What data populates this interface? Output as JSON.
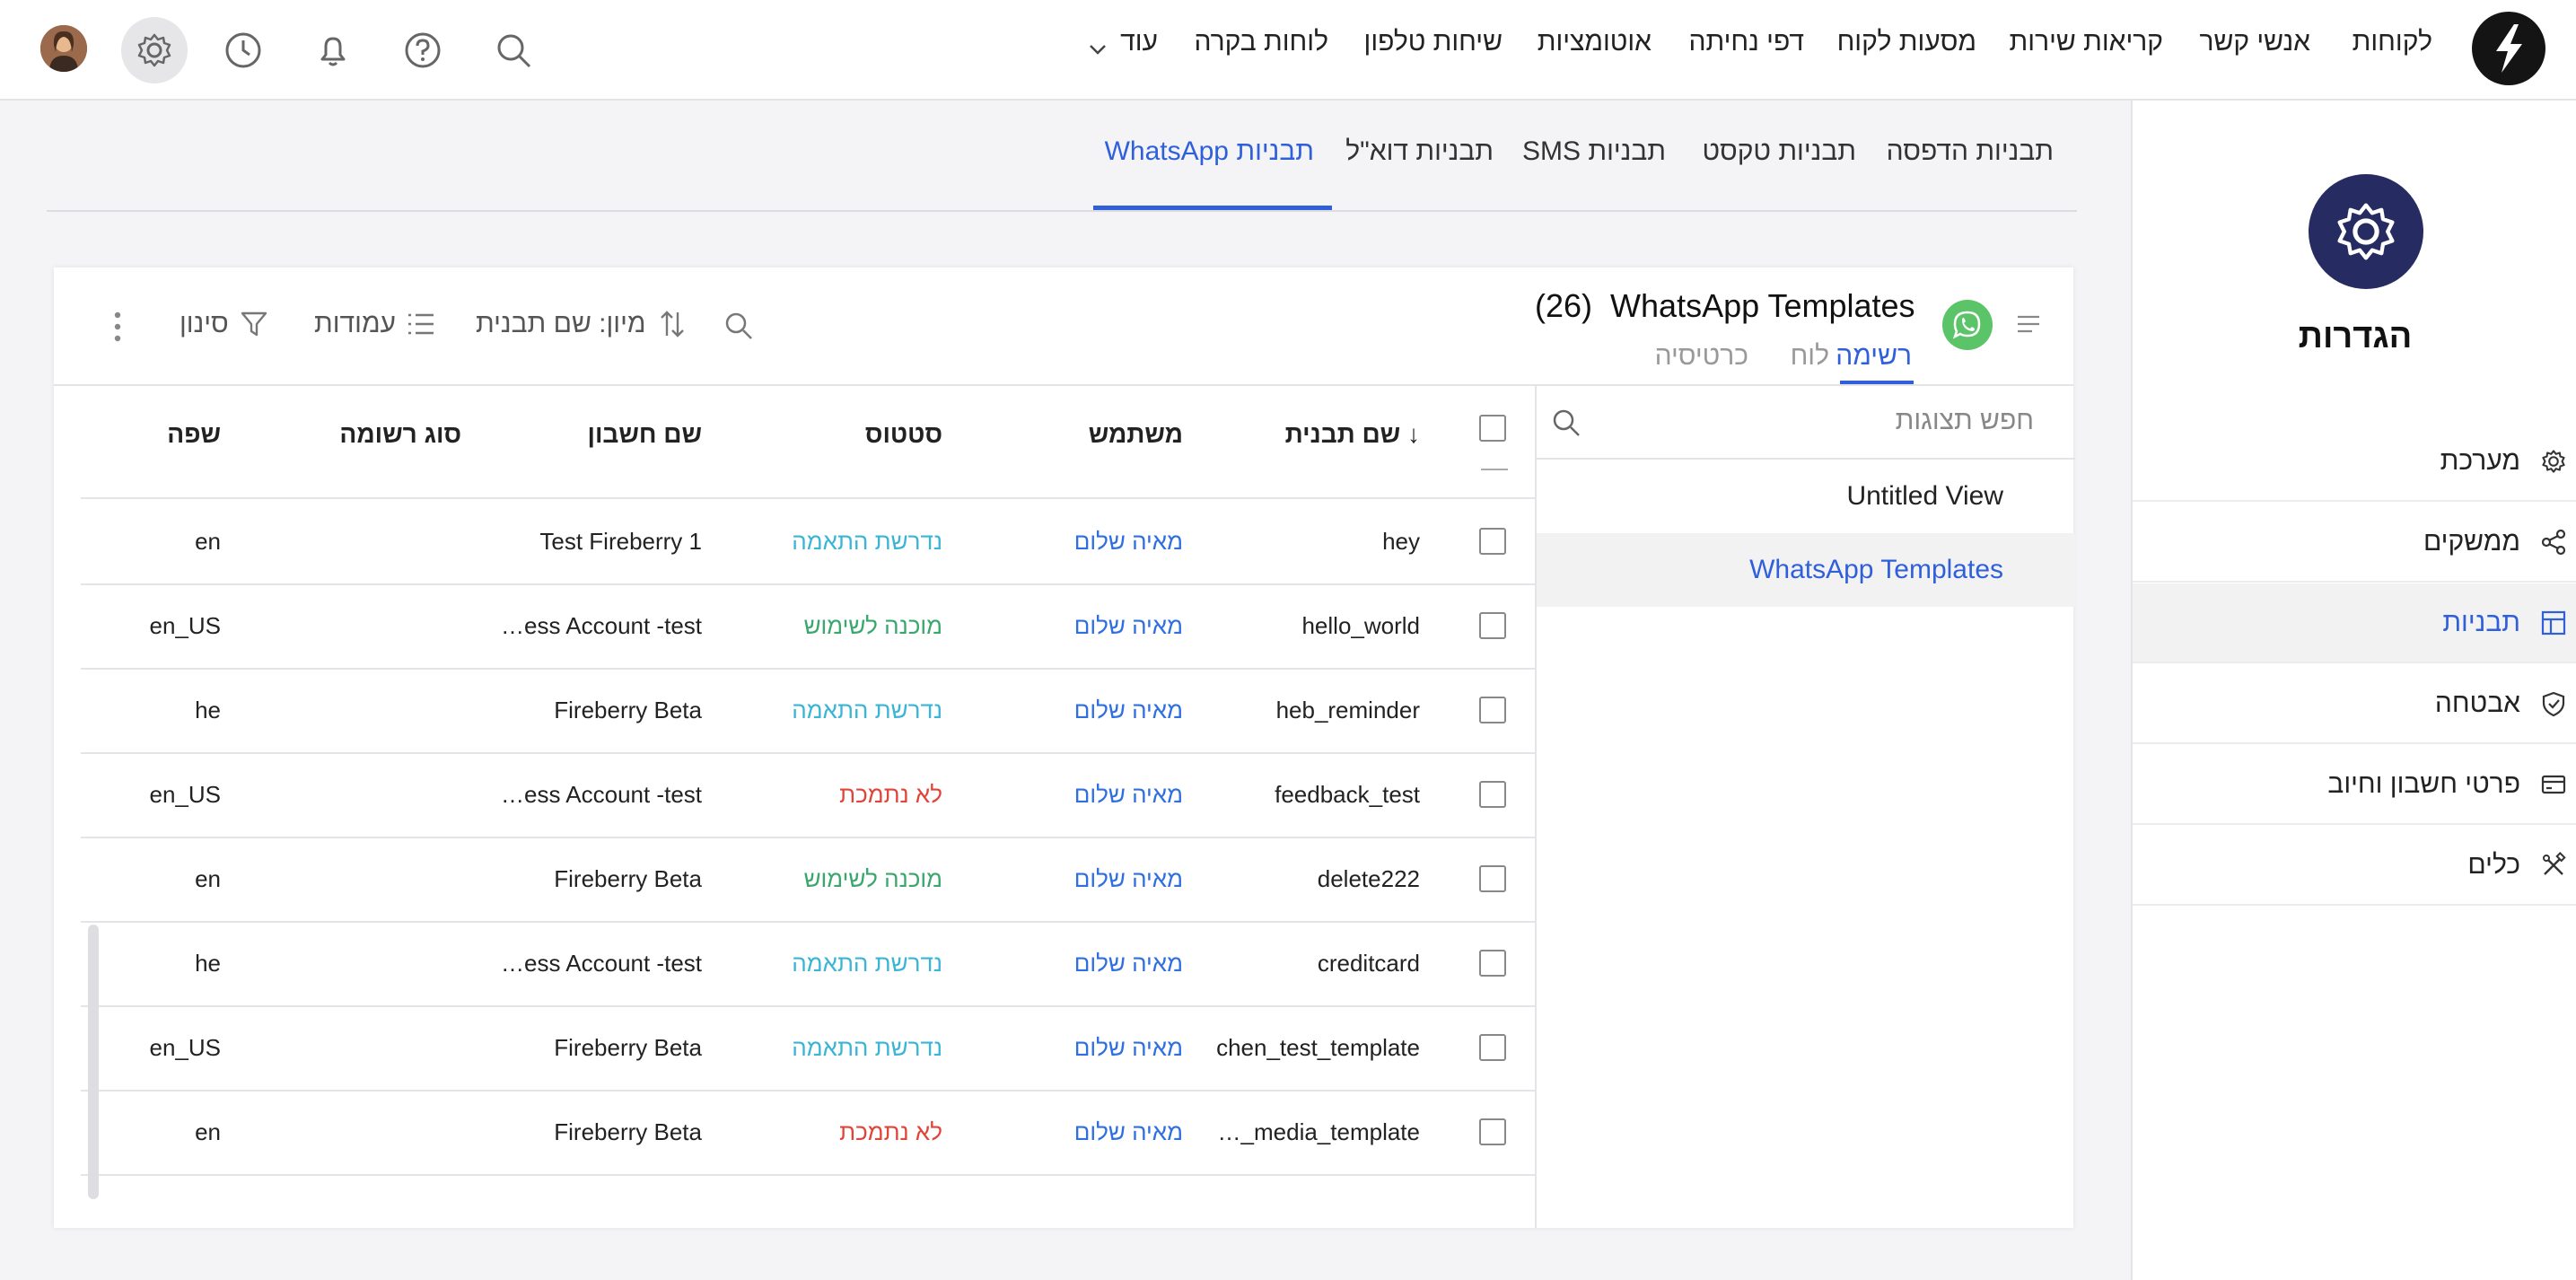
{
  "topnav": {
    "items": [
      "לקוחות",
      "אנשי קשר",
      "קריאות שירות",
      "מסעות לקוח",
      "דפי נחיתה",
      "אוטומציות",
      "שיחות טלפון",
      "לוחות בקרה"
    ],
    "more_label": "עוד"
  },
  "sidebar": {
    "title": "הגדרות",
    "items": [
      {
        "label": "מערכת",
        "icon": "gear-icon"
      },
      {
        "label": "ממשקים",
        "icon": "share-icon"
      },
      {
        "label": "תבניות",
        "icon": "template-icon"
      },
      {
        "label": "אבטחה",
        "icon": "shield-icon"
      },
      {
        "label": "פרטי חשבון וחיוב",
        "icon": "credit-card-icon"
      },
      {
        "label": "כלים",
        "icon": "tools-icon"
      }
    ],
    "active_index": 2
  },
  "tabs": [
    "תבניות הדפסה",
    "תבניות טקסט",
    "תבניות SMS",
    "תבניות דוא\"ל",
    "תבניות WhatsApp"
  ],
  "active_tab": "תבניות WhatsApp",
  "card": {
    "title": "WhatsApp Templates",
    "count": "(26)",
    "view_tabs": [
      "רשימה",
      "לוח",
      "כרטיסיה"
    ],
    "toolbar": {
      "sort_label": "מיון: שם תבנית",
      "columns_label": "עמודות",
      "filter_label": "סינון"
    }
  },
  "views_panel": {
    "search_placeholder": "חפש תצוגות",
    "items": [
      "Untitled View",
      "WhatsApp Templates"
    ],
    "active_index": 1
  },
  "table": {
    "headers": {
      "name": "↓ שם תבנית",
      "user": "משתמש",
      "status": "סטטוס",
      "account": "שם חשבון",
      "record_type": "סוג רשומה",
      "language": "שפה"
    },
    "rows": [
      {
        "name": "hey",
        "user": "מאיה שלום",
        "status": "נדרשת התאמה",
        "status_kind": "match",
        "account": "Test Fireberry 1",
        "language": "en"
      },
      {
        "name": "hello_world",
        "user": "מאיה שלום",
        "status": "מוכנה לשימוש",
        "status_kind": "ready",
        "account": "…ess Account -test",
        "language": "en_US"
      },
      {
        "name": "heb_reminder",
        "user": "מאיה שלום",
        "status": "נדרשת התאמה",
        "status_kind": "match",
        "account": "Fireberry Beta",
        "language": "he"
      },
      {
        "name": "feedback_test",
        "user": "מאיה שלום",
        "status": "לא נתמכת",
        "status_kind": "unsupported",
        "account": "…ess Account -test",
        "language": "en_US"
      },
      {
        "name": "delete222",
        "user": "מאיה שלום",
        "status": "מוכנה לשימוש",
        "status_kind": "ready",
        "account": "Fireberry Beta",
        "language": "en"
      },
      {
        "name": "creditcard",
        "user": "מאיה שלום",
        "status": "נדרשת התאמה",
        "status_kind": "match",
        "account": "…ess Account -test",
        "language": "he"
      },
      {
        "name": "chen_test_template",
        "user": "מאיה שלום",
        "status": "נדרשת התאמה",
        "status_kind": "match",
        "account": "Fireberry Beta",
        "language": "en_US"
      },
      {
        "name": "…_media_template",
        "user": "מאיה שלום",
        "status": "לא נתמכת",
        "status_kind": "unsupported",
        "account": "Fireberry Beta",
        "language": "en"
      }
    ]
  },
  "colors": {
    "accent": "#2f5fdb",
    "status_match": "#3bb5d6",
    "status_ready": "#3aa76d",
    "status_unsupported": "#e0453a",
    "user_link": "#2f6fe0",
    "settings_circle": "#262b62",
    "whatsapp": "#5cc468"
  }
}
